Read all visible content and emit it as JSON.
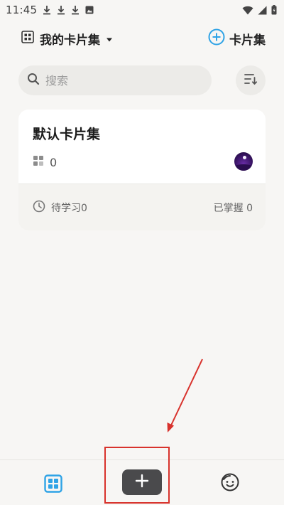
{
  "status_bar": {
    "time": "11:45",
    "left_icons": [
      "download-icon",
      "download-icon",
      "download-icon",
      "image-icon"
    ],
    "right_icons": [
      "wifi-icon",
      "signal-icon",
      "battery-icon"
    ]
  },
  "header": {
    "title": "我的卡片集",
    "add_label": "卡片集",
    "accent_color": "#2fa3e6"
  },
  "search": {
    "placeholder": "搜索"
  },
  "card": {
    "title": "默认卡片集",
    "count": "0",
    "pending_label": "待学习0",
    "mastered_label": "已掌握 0"
  },
  "bottom_nav": {
    "items": [
      "grid-icon",
      "plus-icon",
      "smile-icon"
    ],
    "active": "grid-icon",
    "active_color": "#2fa3e6"
  },
  "annotation": {
    "color": "#d8322c"
  }
}
